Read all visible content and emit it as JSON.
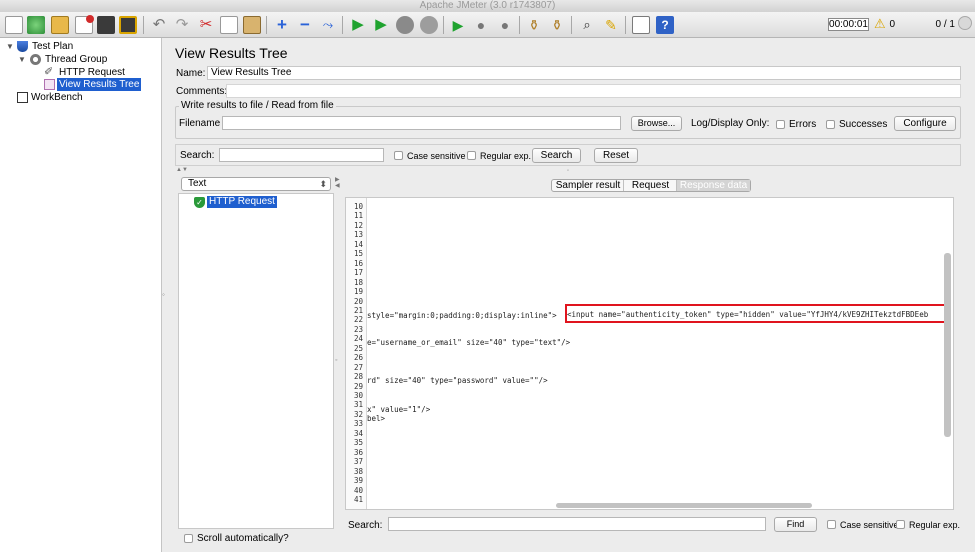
{
  "window": {
    "title": "Apache JMeter (3.0 r1743807)"
  },
  "toolbar": {
    "timer": "00:00:01",
    "warning_count": "0",
    "threads": "0 / 1",
    "icons": [
      "new-icon",
      "templates-icon",
      "open-icon",
      "close-icon",
      "save-icon",
      "save-as-icon",
      "undo-icon",
      "redo-icon",
      "cut-icon",
      "copy-icon",
      "paste-icon",
      "expand-icon",
      "collapse-icon",
      "toggle-icon",
      "start-icon",
      "start-no-pause-icon",
      "stop-icon",
      "shutdown-icon",
      "remote-start-icon",
      "remote-stop-icon",
      "remote-shutdown-icon",
      "clear-icon",
      "clear-all-icon",
      "search-icon",
      "reset-search-icon",
      "function-helper-icon",
      "help-icon"
    ]
  },
  "tree": {
    "items": [
      {
        "label": "Test Plan"
      },
      {
        "label": "Thread Group"
      },
      {
        "label": "HTTP Request"
      },
      {
        "label": "View Results Tree"
      },
      {
        "label": "WorkBench"
      }
    ]
  },
  "panel": {
    "title": "View Results Tree",
    "name_label": "Name:",
    "name_value": "View Results Tree",
    "comments_label": "Comments:",
    "group_title": "Write results to file / Read from file",
    "filename_label": "Filename",
    "filename_value": "",
    "browse_button": "Browse...",
    "log_display_label": "Log/Display Only:",
    "errors_label": "Errors",
    "successes_label": "Successes",
    "configure_button": "Configure"
  },
  "search_bar": {
    "label": "Search:",
    "value": "",
    "case_sensitive_label": "Case sensitive",
    "regex_label": "Regular exp.",
    "search_button": "Search",
    "reset_button": "Reset"
  },
  "results": {
    "renderer_selected": "Text",
    "sample": "HTTP Request",
    "scroll_auto_label": "Scroll automatically?"
  },
  "tabs": {
    "sampler_result": "Sampler result",
    "request": "Request",
    "response_data": "Response data"
  },
  "code": {
    "line_numbers": [
      "10",
      "11",
      "12",
      "13",
      "14",
      "15",
      "16",
      "17",
      "18",
      "19",
      "20",
      "21",
      "22",
      "23",
      "24",
      "25",
      "26",
      "27",
      "28",
      "29",
      "30",
      "31",
      "32",
      "33",
      "34",
      "35",
      "36",
      "37",
      "38",
      "39",
      "40",
      "41"
    ],
    "line_22_prefix": "style=\"margin:0;padding:0;display:inline\">",
    "line_22_highlight": "<input name=\"authenticity_token\" type=\"hidden\" value=\"YfJHY4/kVE9ZHITekztdFBDEeb",
    "line_25": "e=\"username_or_email\" size=\"40\" type=\"text\"/>",
    "line_29": "rd\" size=\"40\" type=\"password\" value=\"\"/>",
    "line_32": "x\" value=\"1\"/>",
    "line_33": "bel>"
  },
  "bottom_search": {
    "label": "Search:",
    "value": "",
    "find_button": "Find",
    "case_sensitive_label": "Case sensitive",
    "regex_label": "Regular exp."
  },
  "colors": {
    "selection": "#1f5fcf",
    "highlight_box": "#e0141e",
    "warning": "#f2c400"
  }
}
